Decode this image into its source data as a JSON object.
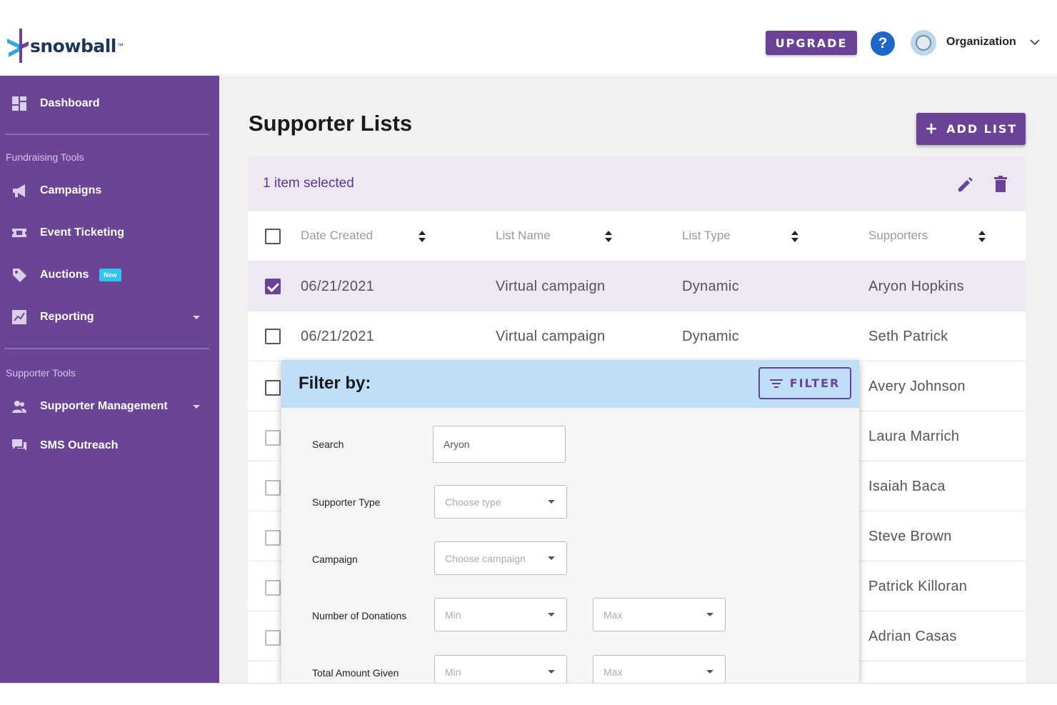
{
  "header": {
    "logo_text": "snowball",
    "logo_tm": "™",
    "upgrade_label": "UPGRADE",
    "help_glyph": "?",
    "org_name": "Organization"
  },
  "sidebar": {
    "dashboard": "Dashboard",
    "section_fundraising": "Fundraising Tools",
    "campaigns": "Campaigns",
    "event_ticketing": "Event Ticketing",
    "auctions": "Auctions",
    "auctions_badge": "New",
    "reporting": "Reporting",
    "section_supporter": "Supporter Tools",
    "supporter_management": "Supporter Management",
    "sms_outreach": "SMS Outreach"
  },
  "main": {
    "page_title": "Supporter Lists",
    "add_list_label": "ADD LIST",
    "add_list_glyph": "+",
    "selection_text": "1 item selected",
    "columns": [
      "Date Created",
      "List Name",
      "List Type",
      "Supporters"
    ],
    "rows": [
      {
        "date": "06/21/2021",
        "name": "Virtual campaign",
        "type": "Dynamic",
        "supporter": "Aryon Hopkins",
        "checked": true
      },
      {
        "date": "06/21/2021",
        "name": "Virtual campaign",
        "type": "Dynamic",
        "supporter": "Seth Patrick",
        "checked": false
      },
      {
        "date": "",
        "name": "",
        "type": "",
        "supporter": "Avery Johnson",
        "checked": false
      },
      {
        "date": "",
        "name": "",
        "type": "",
        "supporter": "Laura Marrich",
        "checked": false
      },
      {
        "date": "",
        "name": "",
        "type": "",
        "supporter": "Isaiah Baca",
        "checked": false
      },
      {
        "date": "",
        "name": "",
        "type": "",
        "supporter": "Steve Brown",
        "checked": false
      },
      {
        "date": "",
        "name": "",
        "type": "",
        "supporter": "Patrick Killoran",
        "checked": false
      },
      {
        "date": "",
        "name": "",
        "type": "",
        "supporter": "Adrian Casas",
        "checked": false
      }
    ]
  },
  "filter": {
    "title": "Filter by:",
    "filter_button": "FILTER",
    "search_label": "Search",
    "search_value": "Aryon",
    "supporter_type_label": "Supporter Type",
    "supporter_type_placeholder": "Choose type",
    "campaign_label": "Campaign",
    "campaign_placeholder": "Choose campaign",
    "donations_label": "Number of Donations",
    "total_label": "Total Amount Given",
    "min_placeholder": "Min",
    "max_placeholder": "Max"
  },
  "colors": {
    "brand_purple": "#6a4397",
    "sidebar_bg": "#6a4596",
    "selection_bg": "#ede8f4",
    "filter_header_bg": "#bfdef8",
    "help_blue": "#1e66c8",
    "badge_cyan": "#2fc3ee"
  },
  "icons": {
    "dashboard": "grid-icon",
    "campaigns": "megaphone-icon",
    "event_ticketing": "ticket-icon",
    "auctions": "tag-icon",
    "reporting": "chart-icon",
    "supporter_management": "people-icon",
    "sms_outreach": "chat-icon",
    "edit": "pencil-icon",
    "delete": "trash-icon",
    "filter": "filter-lines-icon",
    "sort": "sort-icon"
  }
}
